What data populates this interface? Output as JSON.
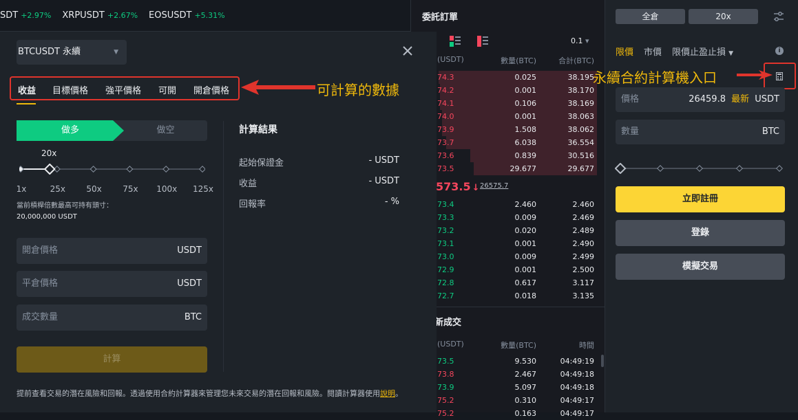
{
  "ticker": [
    {
      "sym": "SDT",
      "pct": "+2.97%"
    },
    {
      "sym": "XRPUSDT",
      "pct": "+2.67%"
    },
    {
      "sym": "EOSUSDT",
      "pct": "+5.31%"
    }
  ],
  "modal": {
    "symbol": "BTCUSDT 永續",
    "tabs": [
      "收益",
      "目標價格",
      "強平價格",
      "可開",
      "開倉價格"
    ],
    "long_label": "做多",
    "short_label": "做空",
    "leverage_value": "20x",
    "leverage_fraction": 0.16,
    "leverage_marks": [
      "1x",
      "25x",
      "50x",
      "75x",
      "100x",
      "125x"
    ],
    "max_position_label": "當前槓桿倍數最高可持有頭寸：",
    "max_position_value": "20,000,000 USDT",
    "fields": [
      {
        "label": "開倉價格",
        "unit": "USDT"
      },
      {
        "label": "平倉價格",
        "unit": "USDT"
      },
      {
        "label": "成交數量",
        "unit": "BTC"
      }
    ],
    "calc_button": "計算",
    "result_title": "計算結果",
    "results": [
      {
        "label": "起始保證金",
        "value": "- USDT"
      },
      {
        "label": "收益",
        "value": "- USDT"
      },
      {
        "label": "回報率",
        "value": "- %"
      }
    ],
    "footer_text": "提前查看交易的潛在風險和回報。透過使用合約計算器來管理您未來交易的潛在回報和風險。閱讀計算器使用",
    "footer_link": "說明",
    "footer_end": "。"
  },
  "orderbook": {
    "title": "委託訂單",
    "precision": "0.1",
    "headers": [
      "(USDT)",
      "數量(BTC)",
      "合計(BTC)"
    ],
    "asks": [
      {
        "p": "74.3",
        "q": "0.025",
        "t": "38.195",
        "depth": 1.0
      },
      {
        "p": "74.2",
        "q": "0.001",
        "t": "38.170",
        "depth": 0.99
      },
      {
        "p": "74.1",
        "q": "0.106",
        "t": "38.169",
        "depth": 0.99
      },
      {
        "p": "74.0",
        "q": "0.001",
        "t": "38.063",
        "depth": 0.98
      },
      {
        "p": "73.9",
        "q": "1.508",
        "t": "38.062",
        "depth": 0.98
      },
      {
        "p": "73.7",
        "q": "6.038",
        "t": "36.554",
        "depth": 0.95
      },
      {
        "p": "73.6",
        "q": "0.839",
        "t": "30.516",
        "depth": 0.8
      },
      {
        "p": "73.5",
        "q": "29.677",
        "t": "29.677",
        "depth": 0.78
      }
    ],
    "last_price": "573.5",
    "last_arrow": "↓",
    "mark_price": "26575.7",
    "bids": [
      {
        "p": "73.4",
        "q": "2.460",
        "t": "2.460"
      },
      {
        "p": "73.3",
        "q": "0.009",
        "t": "2.469"
      },
      {
        "p": "73.2",
        "q": "0.020",
        "t": "2.489"
      },
      {
        "p": "73.1",
        "q": "0.001",
        "t": "2.490"
      },
      {
        "p": "73.0",
        "q": "0.009",
        "t": "2.499"
      },
      {
        "p": "72.9",
        "q": "0.001",
        "t": "2.500"
      },
      {
        "p": "72.8",
        "q": "0.617",
        "t": "3.117"
      },
      {
        "p": "72.7",
        "q": "0.018",
        "t": "3.135"
      }
    ],
    "trades_title": "新成交",
    "trades_headers": [
      "(USDT)",
      "數量(BTC)",
      "時間"
    ],
    "trades": [
      {
        "p": "73.5",
        "q": "9.530",
        "t": "04:49:19",
        "c": "green"
      },
      {
        "p": "73.8",
        "q": "2.467",
        "t": "04:49:18",
        "c": "red"
      },
      {
        "p": "73.9",
        "q": "5.097",
        "t": "04:49:18",
        "c": "green"
      },
      {
        "p": "75.2",
        "q": "0.310",
        "t": "04:49:17",
        "c": "red"
      },
      {
        "p": "75.2",
        "q": "0.163",
        "t": "04:49:17",
        "c": "red"
      }
    ]
  },
  "rightpanel": {
    "margin_mode": "全倉",
    "leverage": "20x",
    "order_types": [
      "限價",
      "市價",
      "限價止盈止損"
    ],
    "price_label": "價格",
    "price_value": "26459.8",
    "price_latest": "最新",
    "price_unit": "USDT",
    "qty_label": "數量",
    "qty_unit": "BTC",
    "register_button": "立即註冊",
    "login_button": "登錄",
    "demo_button": "模擬交易"
  },
  "annotations": {
    "data_note": "可計算的數據",
    "entry_note": "永續合約計算機入口"
  },
  "colors": {
    "accent": "#f0b90b",
    "green": "#0ecb81",
    "red": "#f6465d",
    "annot_red": "#e0342c"
  }
}
